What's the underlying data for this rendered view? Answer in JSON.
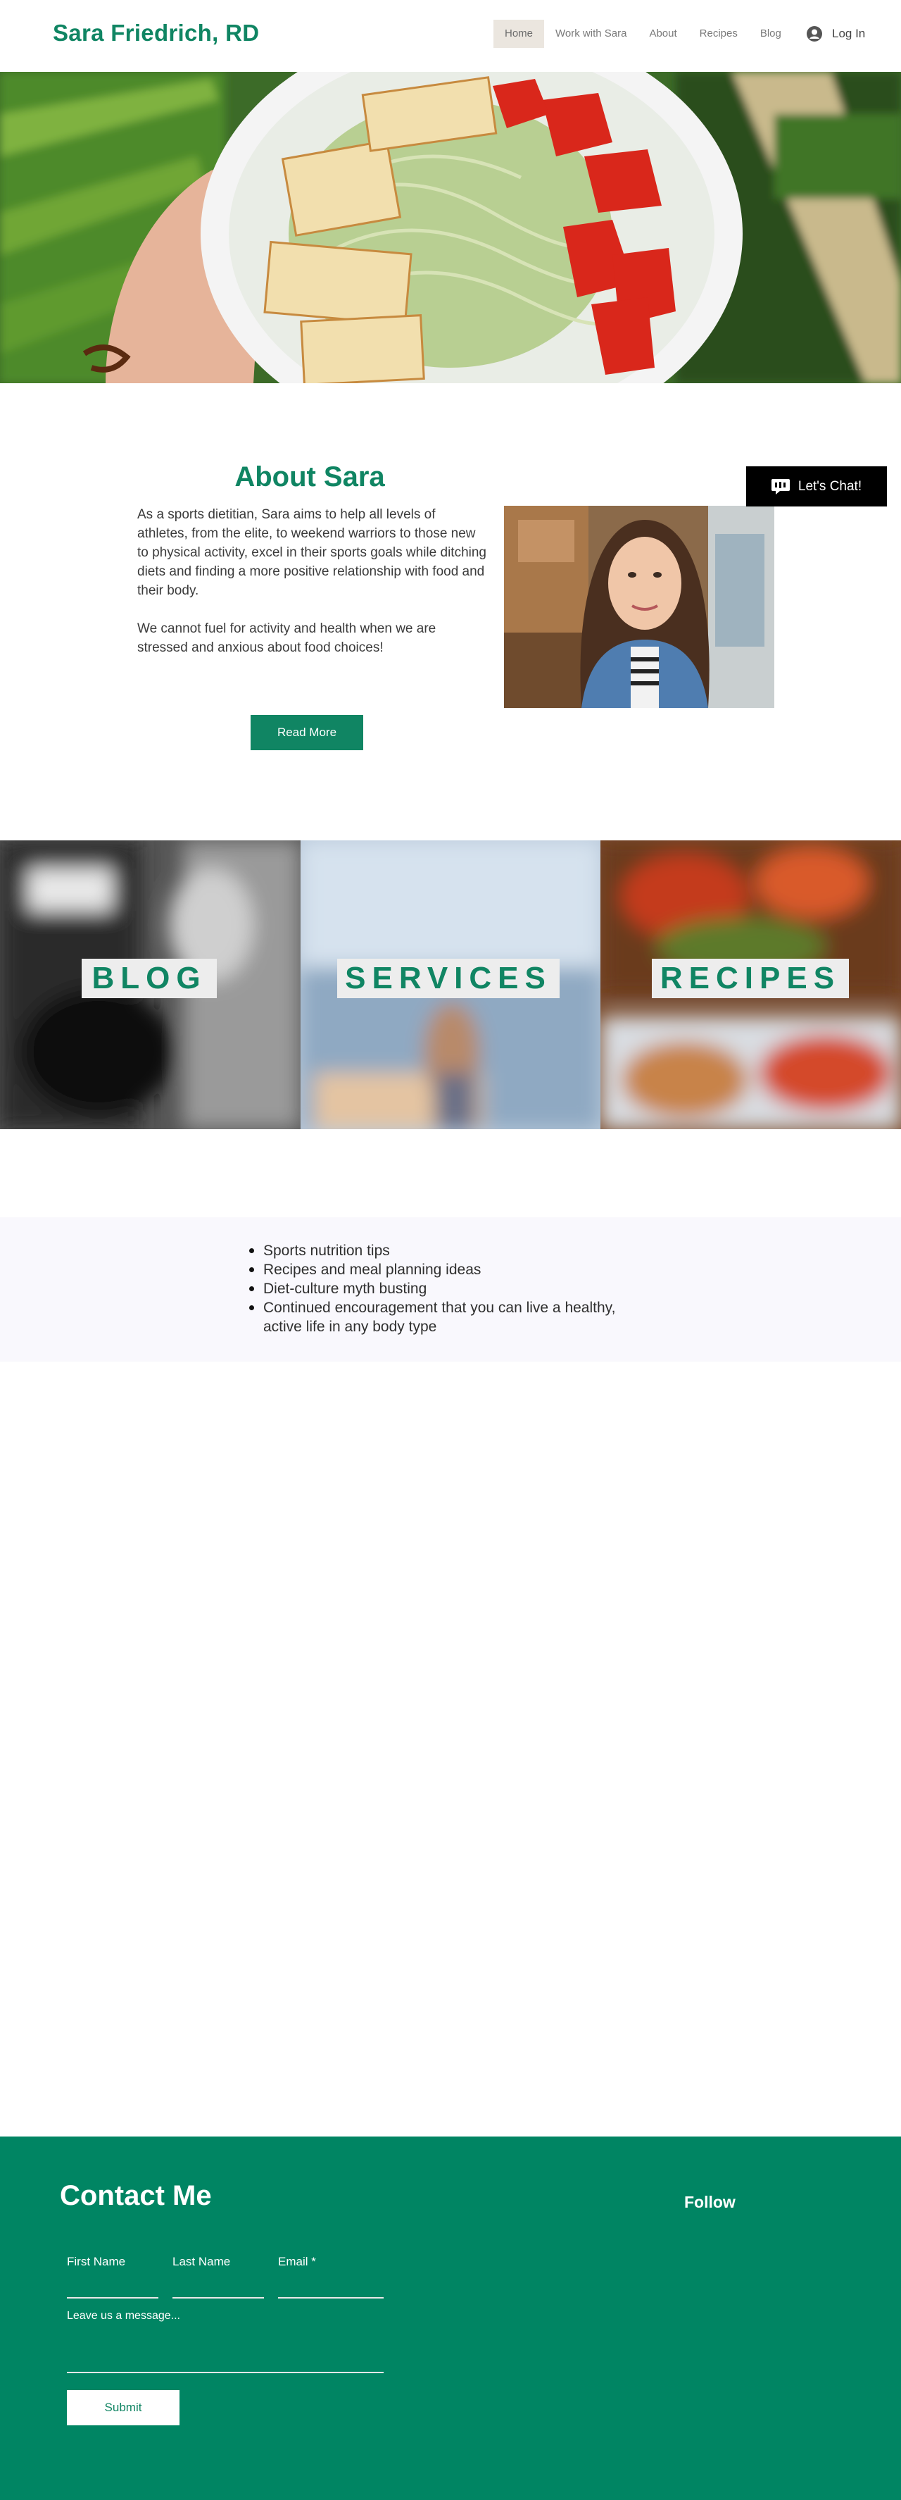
{
  "header": {
    "brand": "Sara Friedrich, RD",
    "nav": [
      "Home",
      "Work with Sara",
      "About",
      "Recipes",
      "Blog"
    ],
    "login_label": "Log In"
  },
  "hero": {
    "image": "salad-bowl-with-halloumi-and-tomatoes"
  },
  "about": {
    "title": "About Sara",
    "paragraph1": "As a sports dietitian, Sara aims to help all levels of athletes, from the elite, to weekend warriors to those new to physical activity, excel in their sports goals while ditching diets and finding a more positive relationship with food and their body.",
    "paragraph2": "We cannot fuel for activity and health when we are stressed and anxious about food choices!",
    "button": "Read More",
    "portrait": "portrait-photo"
  },
  "chat": {
    "label": "Let's Chat!"
  },
  "tiles": [
    "BLOG",
    "SERVICES",
    "RECIPES"
  ],
  "bullets": [
    "Sports nutrition tips",
    "Recipes and meal planning ideas",
    "Diet-culture myth busting",
    "Continued encouragement that you can live a healthy, active life in any body type"
  ],
  "footer": {
    "title": "Contact Me",
    "follow": "Follow",
    "first_name": "First Name",
    "last_name": "Last Name",
    "email": "Email *",
    "message": "Leave us a message...",
    "submit": "Submit"
  },
  "colors": {
    "brand": "#108563",
    "footer": "#008563",
    "nav_active": "#ebe6df"
  }
}
